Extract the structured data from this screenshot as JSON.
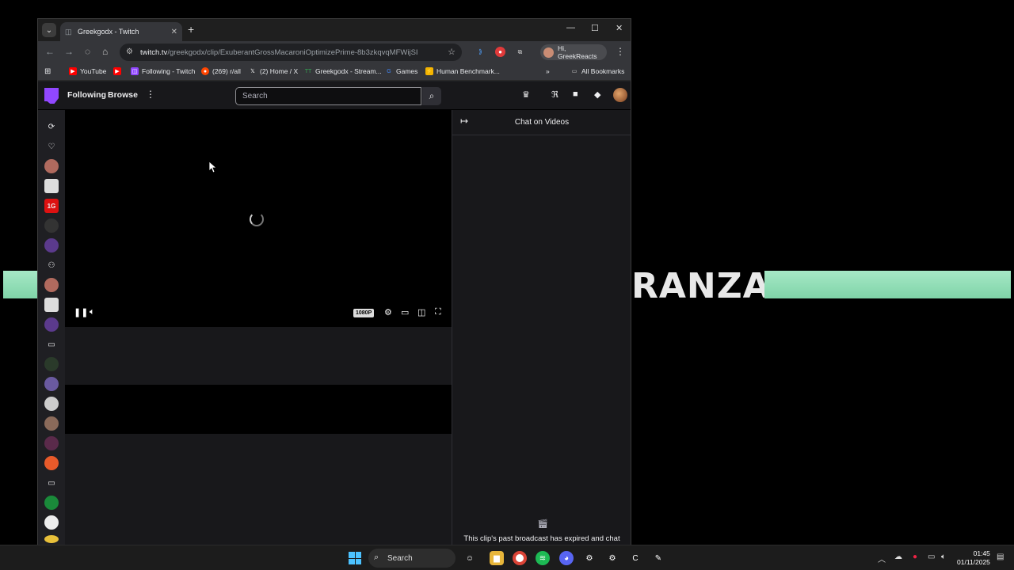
{
  "background": {
    "banner_text": "RANZA",
    "banner_color": "#8fdcb4"
  },
  "browser": {
    "tab": {
      "title": "Greekgodx - Twitch",
      "close": "✕"
    },
    "newtab": "+",
    "window_controls": {
      "minimize": "—",
      "maximize": "☐",
      "close": "✕"
    },
    "url": {
      "host": "twitch.tv",
      "path": "/greekgodx/clip/ExuberantGrossMacaroniOptimizePrime-8b3zkqvqMFWijSI"
    },
    "profile_label": "Hi, GreekReacts",
    "bookmarks": [
      {
        "label": "YouTube",
        "icon": "youtube-icon",
        "color": "#ff0000"
      },
      {
        "label": "",
        "icon": "youtube-icon",
        "color": "#ff0000"
      },
      {
        "label": "Following - Twitch",
        "icon": "twitch-icon",
        "color": "#9147ff"
      },
      {
        "label": "(269) r/all",
        "icon": "reddit-icon",
        "color": "#ff4500"
      },
      {
        "label": "(2) Home / X",
        "icon": "x-icon",
        "color": "#000000"
      },
      {
        "label": "Greekgodx - Stream...",
        "icon": "tracker-icon",
        "color": "#34a853"
      },
      {
        "label": "Games",
        "icon": "google-icon",
        "color": "#4285f4"
      },
      {
        "label": "Human Benchmark...",
        "icon": "benchmark-icon",
        "color": "#f4b400"
      }
    ],
    "more_bookmarks": "»",
    "all_bookmarks": "All Bookmarks"
  },
  "twitch": {
    "nav": {
      "following": "Following",
      "browse": "Browse",
      "more": "⋮"
    },
    "search_placeholder": "Search",
    "player": {
      "quality": "1080P"
    },
    "chat": {
      "title": "Chat on Videos",
      "message": "This clip's past broadcast has expired and chat"
    },
    "sidenav_icons": [
      "recommended-icon",
      "heart-icon",
      "avatar",
      "avatar",
      "avatar",
      "avatar",
      "avatar",
      "add-friend-icon",
      "avatar",
      "avatar",
      "avatar",
      "camera-icon",
      "avatar",
      "avatar",
      "avatar",
      "avatar",
      "avatar",
      "avatar",
      "camera-icon",
      "avatar",
      "avatar",
      "avatar"
    ]
  },
  "taskbar": {
    "search_label": "Search",
    "time": "01:45",
    "date": "01/11/2025"
  },
  "colors": {
    "twitch_purple": "#9147ff",
    "twitch_bg": "#0e0e10",
    "panel_bg": "#18181b"
  }
}
